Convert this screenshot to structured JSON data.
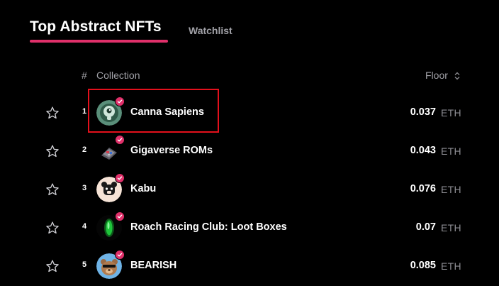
{
  "header": {
    "title": "Top Abstract NFTs",
    "watchlist_tab": "Watchlist"
  },
  "table": {
    "columns": {
      "rank": "#",
      "collection": "Collection",
      "floor": "Floor"
    },
    "rows": [
      {
        "rank": "1",
        "name": "Canna Sapiens",
        "floor": "0.037",
        "unit": "ETH",
        "verified": true
      },
      {
        "rank": "2",
        "name": "Gigaverse ROMs",
        "floor": "0.043",
        "unit": "ETH",
        "verified": true
      },
      {
        "rank": "3",
        "name": "Kabu",
        "floor": "0.076",
        "unit": "ETH",
        "verified": true
      },
      {
        "rank": "4",
        "name": "Roach Racing Club: Loot Boxes",
        "floor": "0.07",
        "unit": "ETH",
        "verified": true
      },
      {
        "rank": "5",
        "name": "BEARISH",
        "floor": "0.085",
        "unit": "ETH",
        "verified": true
      }
    ]
  },
  "colors": {
    "accent": "#e0306a",
    "background": "#000000",
    "muted_text": "#a2a2a8",
    "highlight": "#e4101c"
  }
}
